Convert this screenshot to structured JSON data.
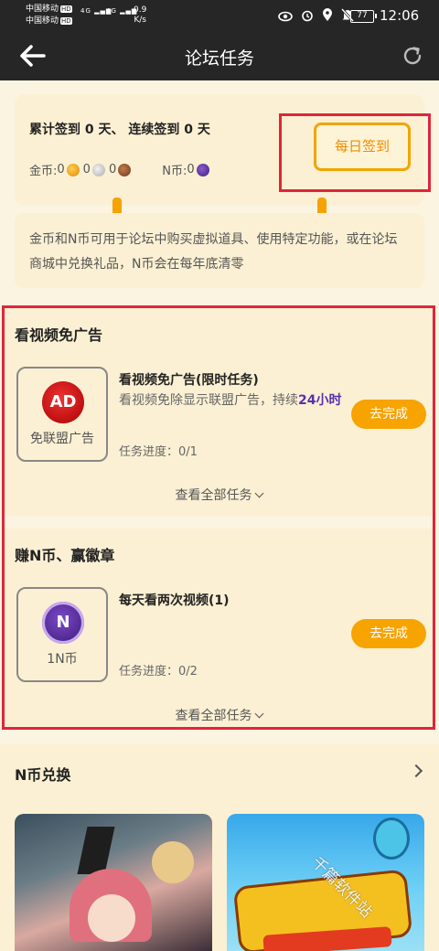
{
  "status_bar": {
    "carrier1": "中国移动",
    "carrier2": "中国移动",
    "hd": "HD",
    "net1": "4G",
    "net2": "4G",
    "speed_value": "0.9",
    "speed_unit": "K/s",
    "battery": "77",
    "time": "12:06"
  },
  "header": {
    "title": "论坛任务"
  },
  "sign_in": {
    "summary": "累计签到 0 天、 连续签到 0 天",
    "gold_label": "金币:",
    "gold_value": "0",
    "silver_value": "0",
    "bronze_value": "0",
    "n_label": "N币:",
    "n_value": "0",
    "daily_button": "每日签到"
  },
  "info_text": "金币和N币可用于论坛中购买虚拟道具、使用特定功能，或在论坛商城中兑换礼品，N币会在每年底清零",
  "sections": [
    {
      "title": "看视频免广告",
      "task": {
        "thumb_text": "AD",
        "thumb_label": "免联盟广告",
        "title": "看视频免广告(限时任务)",
        "desc_prefix": "看视频免除显示联盟广告，持续",
        "desc_highlight": "24小时",
        "progress": "任务进度：0/1",
        "button": "去完成"
      },
      "view_all": "查看全部任务"
    },
    {
      "title": "赚N币、赢徽章",
      "task": {
        "thumb_text": "N",
        "thumb_label": "1N币",
        "title": "每天看两次视频(1)",
        "progress": "任务进度：0/2",
        "button": "去完成"
      },
      "view_all": "查看全部任务"
    }
  ],
  "exchange": {
    "title": "N币兑换"
  },
  "watermark": "千篇软件站",
  "colors": {
    "accent": "#f7a300",
    "highlight_border": "#e0253a",
    "background": "#faf4e1",
    "header": "#262626",
    "purple": "#5a2fb0"
  }
}
